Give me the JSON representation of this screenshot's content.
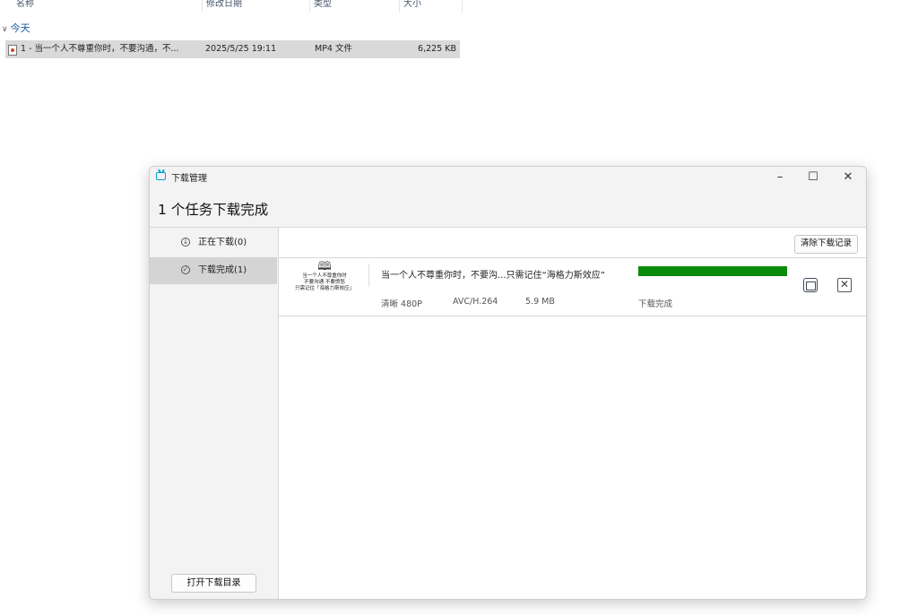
{
  "explorer": {
    "columns": {
      "name": "名称",
      "date": "修改日期",
      "type": "类型",
      "size": "大小"
    },
    "group_label": "今天",
    "file": {
      "name": "1 - 当一个人不尊重你时，不要沟通，不...",
      "date": "2025/5/25 19:11",
      "type": "MP4 文件",
      "size": "6,225 KB"
    }
  },
  "window": {
    "title": "下载管理",
    "heading": "1 个任务下载完成",
    "controls": {
      "minimize": "–",
      "maximize": "☐",
      "close": "✕"
    },
    "sidebar": {
      "items": [
        {
          "label": "正在下载(0)",
          "icon": "download-icon",
          "active": false
        },
        {
          "label": "下载完成(1)",
          "icon": "check-circle-icon",
          "active": true
        }
      ],
      "open_dir_label": "打开下载目录"
    },
    "main": {
      "clear_label": "清除下载记录",
      "task": {
        "thumb_lines": [
          "当一个人不尊重你时",
          "不要沟通 不要愤怒",
          "只需记住「海格力斯效应」"
        ],
        "title": "当一个人不尊重你时，不要沟...只需记住“海格力斯效应”",
        "quality": "清晰 480P",
        "codec": "AVC/H.264",
        "size": "5.9 MB",
        "status": "下载完成",
        "progress": 1.0,
        "progress_color": "#0a8a0a"
      }
    }
  }
}
